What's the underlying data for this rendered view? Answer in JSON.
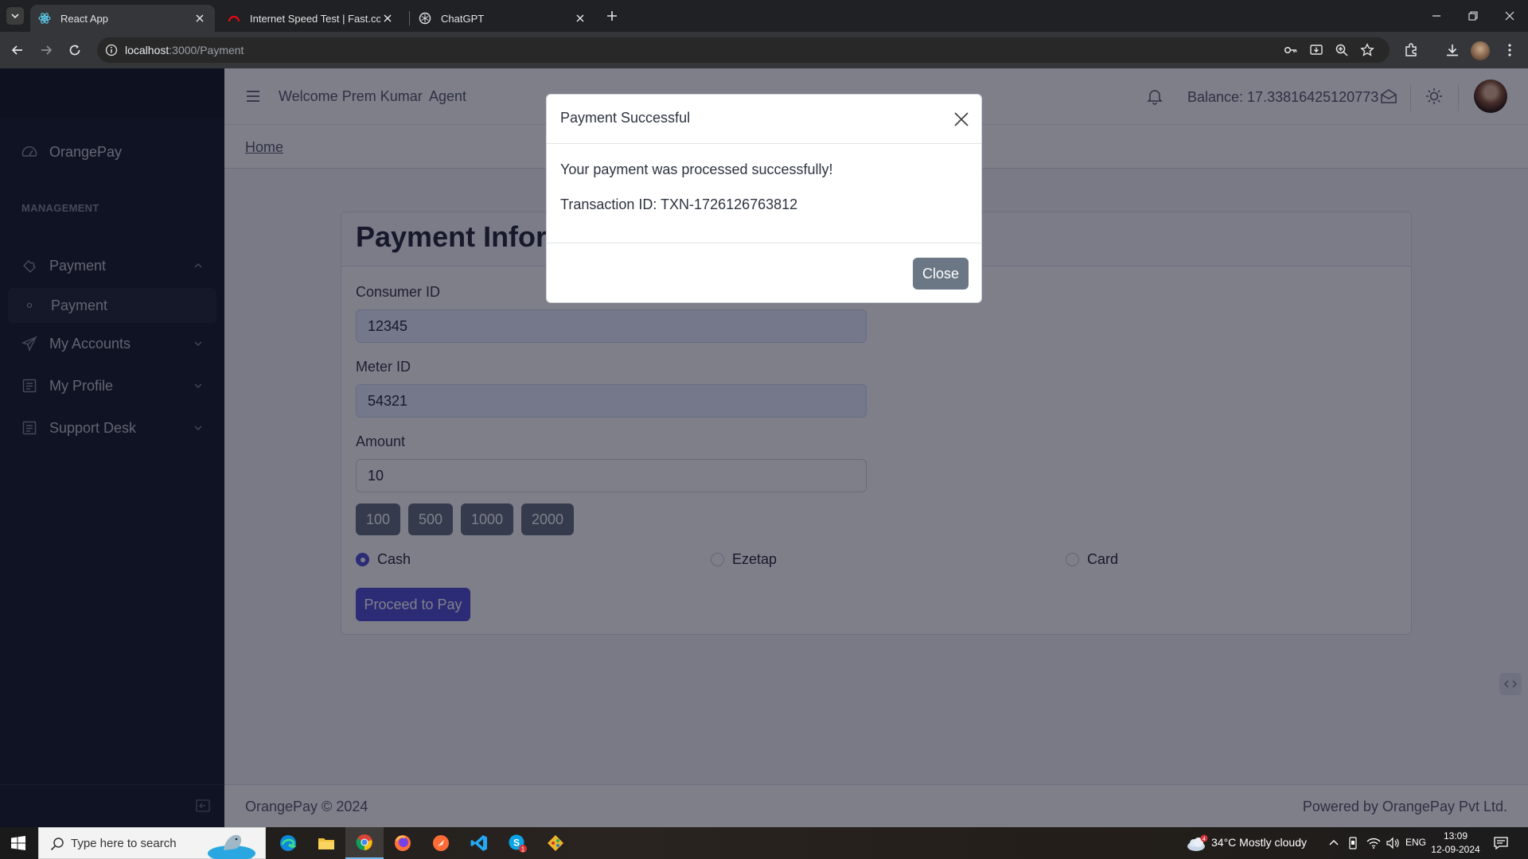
{
  "browser": {
    "tabs": [
      {
        "title": "React App",
        "active": true,
        "icon": "react-icon"
      },
      {
        "title": "Internet Speed Test | Fast.com",
        "active": false,
        "icon": "fast-icon"
      },
      {
        "title": "ChatGPT",
        "active": false,
        "icon": "chatgpt-icon"
      }
    ],
    "url_host": "localhost",
    "url_path": ":3000/Payment"
  },
  "sidebar": {
    "brand": "OrangePay",
    "section_title": "MANAGEMENT",
    "items": [
      {
        "label": "Payment",
        "icon": "puzzle-icon",
        "expanded": true
      },
      {
        "label": "Payment",
        "sub": true
      },
      {
        "label": "My Accounts",
        "icon": "send-icon"
      },
      {
        "label": "My Profile",
        "icon": "note-icon"
      },
      {
        "label": "Support Desk",
        "icon": "note-icon"
      }
    ]
  },
  "header": {
    "welcome": "Welcome Prem Kumar",
    "role": "Agent",
    "balance": "Balance: 17.33816425120773",
    "breadcrumb": "Home"
  },
  "form": {
    "title": "Payment Information",
    "consumer_label": "Consumer ID",
    "consumer_value": "12345",
    "meter_label": "Meter ID",
    "meter_value": "54321",
    "amount_label": "Amount",
    "amount_value": "10",
    "quick_amounts": [
      "100",
      "500",
      "1000",
      "2000"
    ],
    "methods": [
      "Cash",
      "Ezetap",
      "Card"
    ],
    "selected_method": "Cash",
    "submit_label": "Proceed to Pay"
  },
  "footer": {
    "copyright": "OrangePay © 2024",
    "powered": "Powered by OrangePay Pvt Ltd."
  },
  "modal": {
    "title": "Payment Successful",
    "message": "Your payment was processed successfully!",
    "transaction": "Transaction ID: TXN-1726126763812",
    "close_label": "Close"
  },
  "taskbar": {
    "search_placeholder": "Type here to search",
    "weather": "34°C  Mostly cloudy",
    "weather_badge": "4",
    "language": "ENG",
    "time": "13:09",
    "date": "12-09-2024",
    "skype_badge": "1"
  },
  "colors": {
    "sidebar_bg": "#212631",
    "primary": "#5856d6",
    "secondary": "#6b7785"
  }
}
